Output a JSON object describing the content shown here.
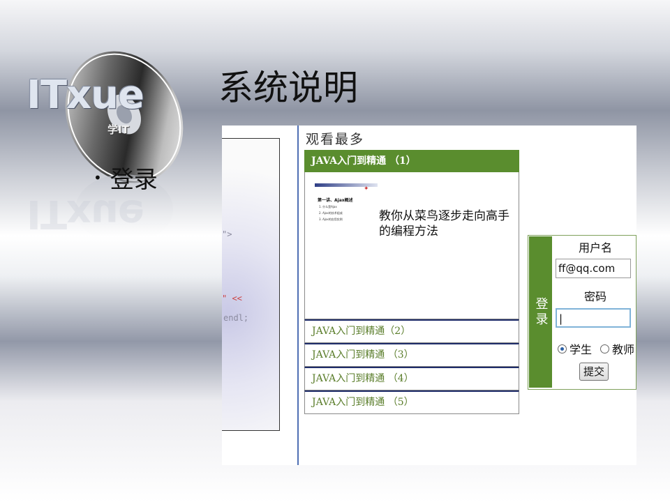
{
  "logo": {
    "text": "ITxue",
    "sub": "学IT"
  },
  "slide": {
    "title": "系统说明",
    "bullet": "登录"
  },
  "code_snippet": {
    "line1": "\">",
    "line2": "\" << ",
    "line3": "endl;"
  },
  "screenshot": {
    "section_title": "观看最多",
    "featured": {
      "title": "JAVA入门到精通 （1）",
      "description": "教你从菜鸟逐步走向高手的编程方法",
      "thumb_heading": "第一讲、Ajax概述",
      "thumb_items": [
        "1. 什么是Ajax",
        "2. Ajax的技术组成",
        "3. Ajax的应用实例"
      ]
    },
    "videos": [
      {
        "title": "JAVA入门到精通（2）"
      },
      {
        "title": "JAVA入门到精通 （3）"
      },
      {
        "title": "JAVA入门到精通 （4）"
      },
      {
        "title": "JAVA入门到精通 （5）"
      }
    ],
    "login": {
      "side_label": "登录",
      "username_label": "用户名",
      "username_value": "ff@qq.com",
      "password_label": "密码",
      "password_value": "|",
      "role_student": "学生",
      "role_teacher": "教师",
      "selected_role": "学生",
      "submit": "提交"
    }
  },
  "colors": {
    "green": "#5a8d2e",
    "navy": "#1f2d6a",
    "link_green": "#5a7d2a"
  }
}
